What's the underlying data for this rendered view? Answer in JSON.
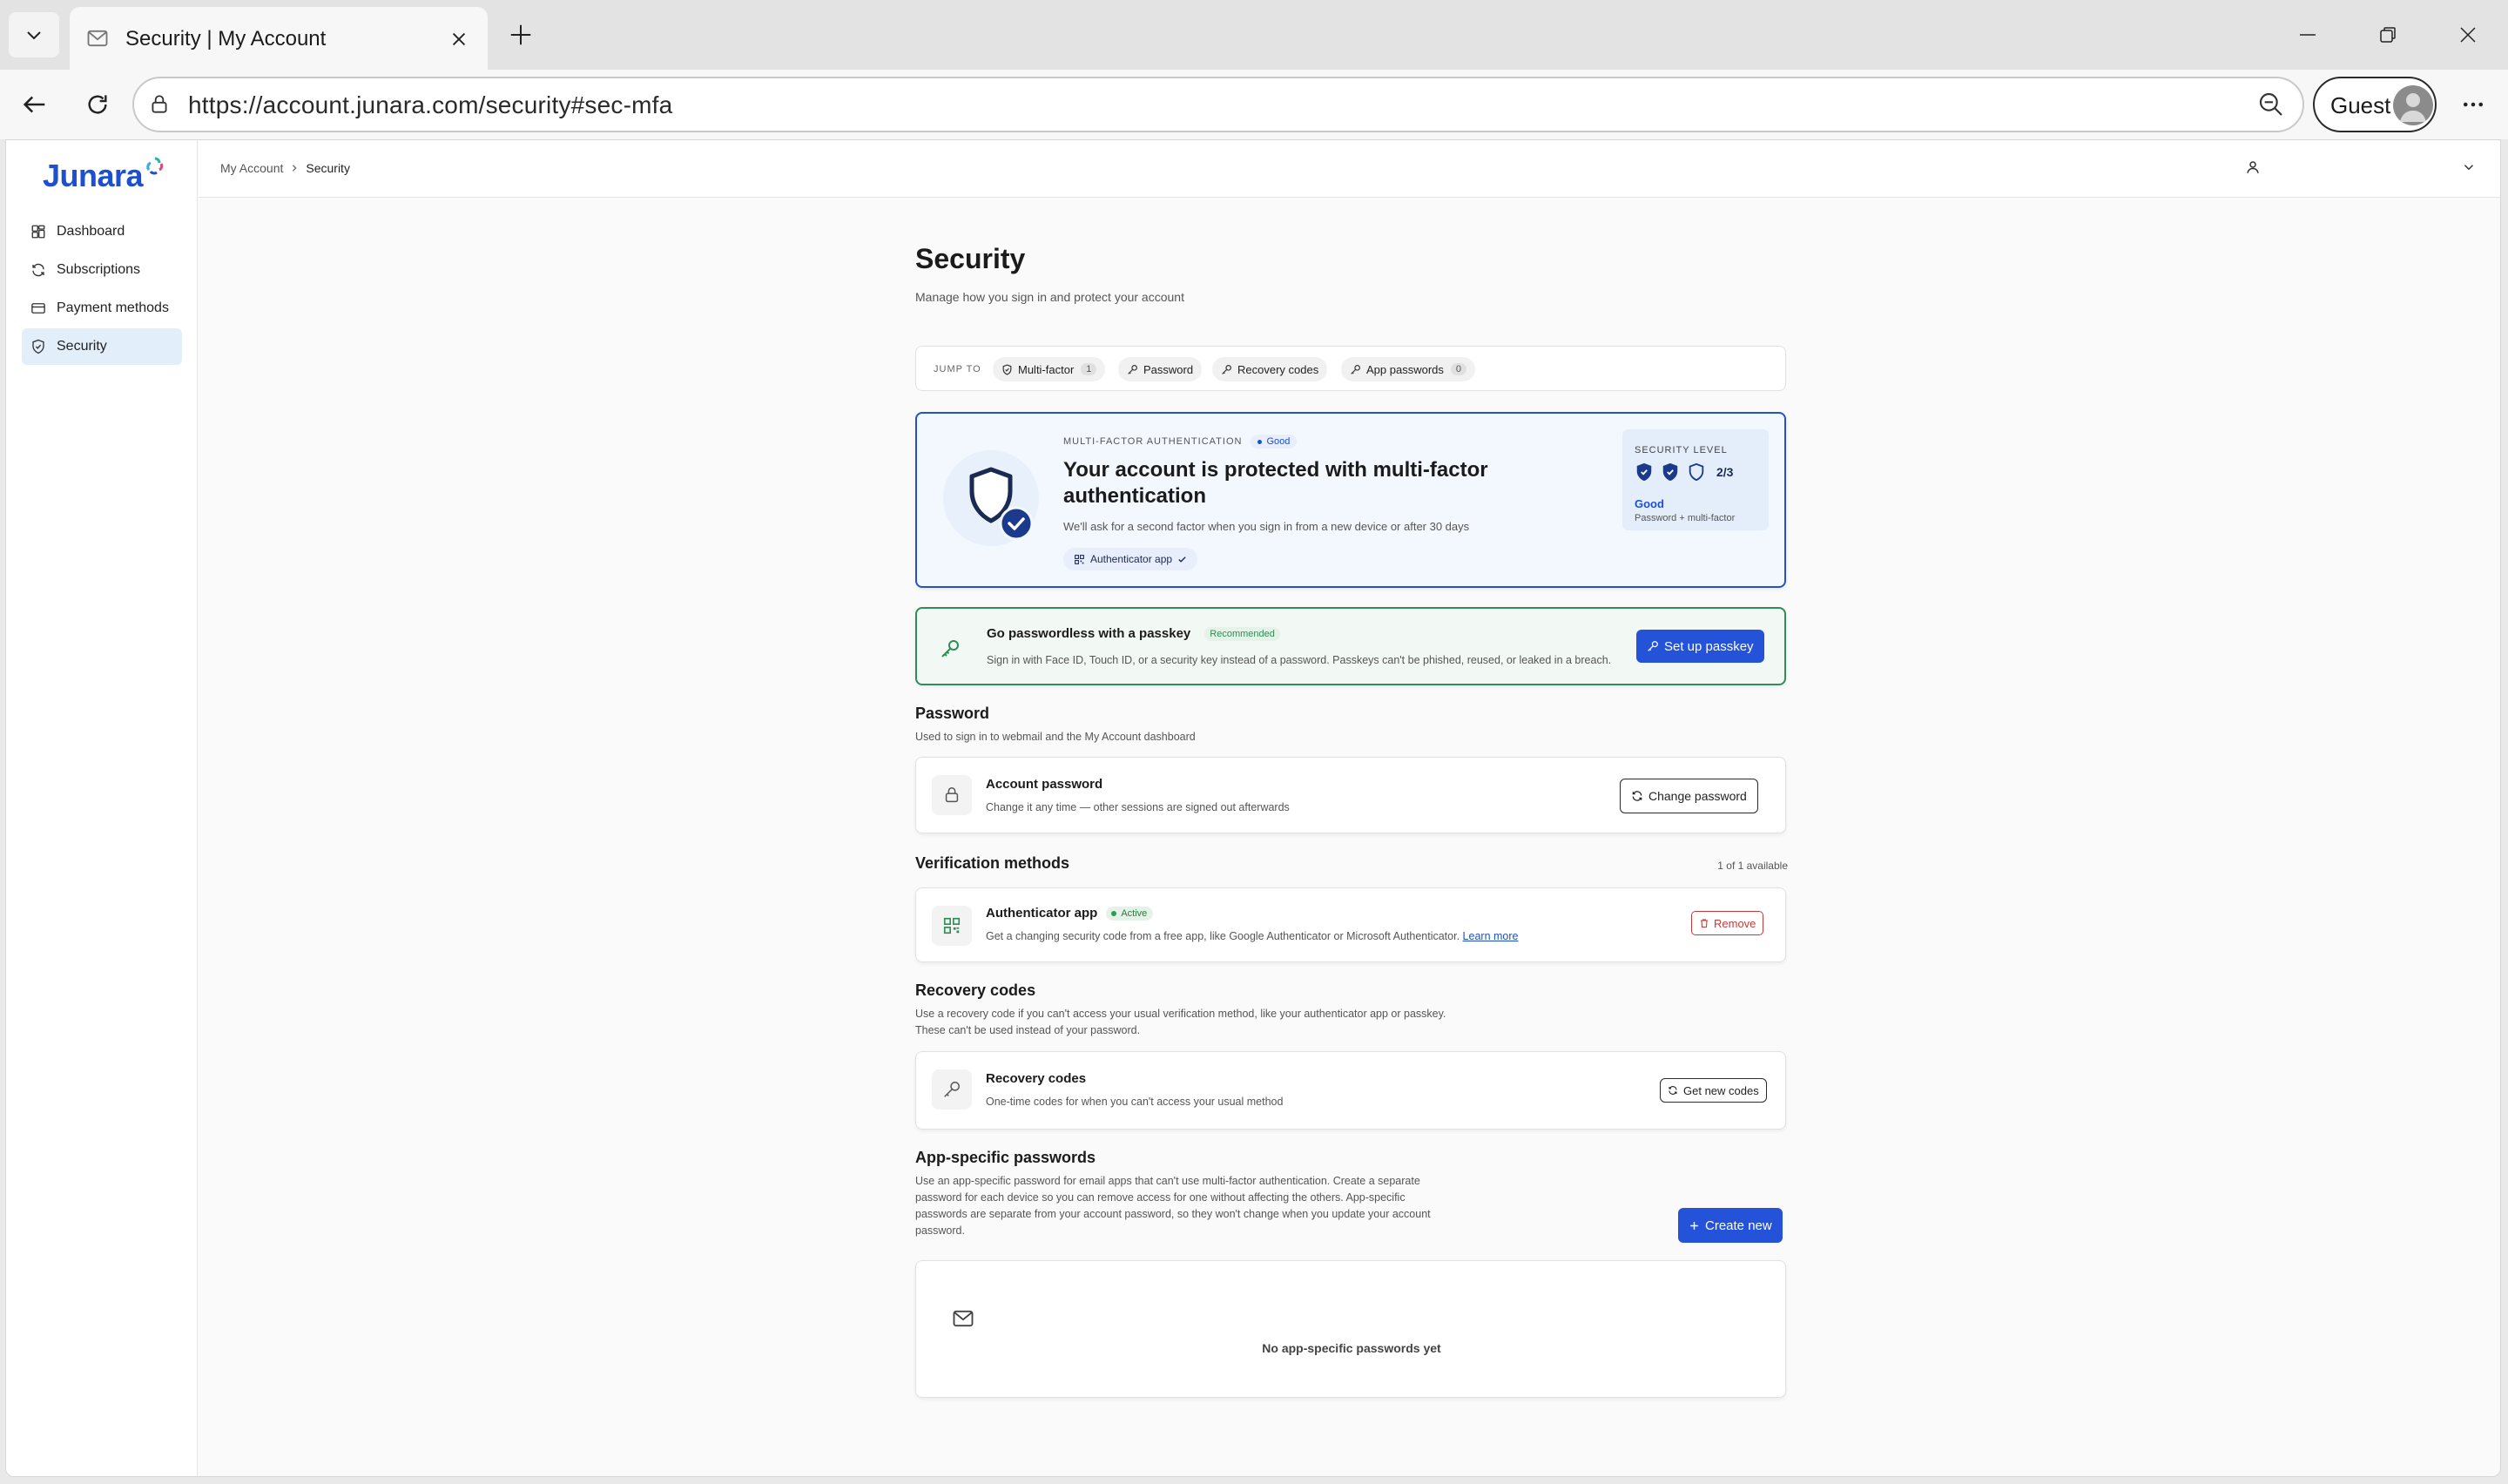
{
  "browser": {
    "tab_title": "Security | My Account",
    "url": "https://account.junara.com/security#sec-mfa",
    "profile_label": "Guest"
  },
  "app": {
    "logo_text": "Junara",
    "brand_color": "#1d4fd1",
    "sidebar": {
      "items": [
        {
          "label": "Dashboard",
          "icon": "dashboard-icon"
        },
        {
          "label": "Subscriptions",
          "icon": "refresh-icon"
        },
        {
          "label": "Payment methods",
          "icon": "credit-card-icon"
        },
        {
          "label": "Security",
          "icon": "shield-icon",
          "active": true
        }
      ]
    },
    "breadcrumb": {
      "root": "My Account",
      "current": "Security"
    }
  },
  "page": {
    "title": "Security",
    "subtitle": "Manage how you sign in and protect your account"
  },
  "jump_to": {
    "label": "JUMP TO",
    "chips": [
      {
        "label": "Multi-factor",
        "count": "1",
        "icon": "shield-icon"
      },
      {
        "label": "Password",
        "icon": "key-icon"
      },
      {
        "label": "Recovery codes",
        "icon": "key-icon"
      },
      {
        "label": "App passwords",
        "count": "0",
        "icon": "key-icon"
      }
    ]
  },
  "mfa_card": {
    "kicker": "MULTI-FACTOR AUTHENTICATION",
    "status": "Good",
    "headline": "Your account is protected with multi-factor authentication",
    "description": "We'll ask for a second factor when you sign in from a new device or after 30 days",
    "method_chip": "Authenticator app",
    "security_level": {
      "title": "SECURITY LEVEL",
      "filled": 2,
      "total": 3,
      "ratio": "2/3",
      "grade": "Good",
      "detail": "Password + multi-factor"
    }
  },
  "passkey_banner": {
    "title": "Go passwordless with a passkey",
    "badge": "Recommended",
    "description": "Sign in with Face ID, Touch ID, or a security key instead of a password. Passkeys can't be phished, reused, or leaked in a breach.",
    "button": "Set up passkey",
    "accent": "#2f8d57"
  },
  "password_section": {
    "heading": "Password",
    "description": "Used to sign in to webmail and the My Account dashboard",
    "row": {
      "title": "Account password",
      "description": "Change it any time — other sessions are signed out afterwards",
      "button": "Change password"
    }
  },
  "verification_section": {
    "heading": "Verification methods",
    "count": "1 of 1 available",
    "row": {
      "title": "Authenticator app",
      "status": "Active",
      "description": "Get a changing security code from a free app, like Google Authenticator or Microsoft Authenticator.",
      "link": "Learn more",
      "button": "Remove"
    }
  },
  "recovery_section": {
    "heading": "Recovery codes",
    "description_line1": "Use a recovery code if you can't access your usual verification method, like your authenticator app or passkey.",
    "description_line2": "These can't be used instead of your password.",
    "row": {
      "title": "Recovery codes",
      "description": "One-time codes for when you can't access your usual method",
      "button": "Get new codes"
    }
  },
  "app_passwords_section": {
    "heading": "App-specific passwords",
    "description_lines": [
      "Use an app-specific password for email apps that can't use multi-factor authentication. Create a separate",
      "password for each device so you can remove access for one without affecting the others. App-specific",
      "passwords are separate from your account password, so they won't change when you update your account",
      "password."
    ],
    "button": "Create new",
    "empty_text": "No app-specific passwords yet"
  }
}
